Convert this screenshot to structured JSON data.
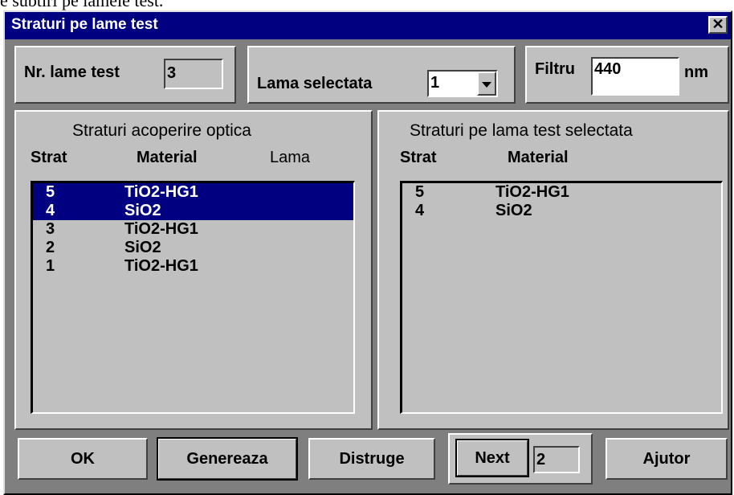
{
  "document": {
    "text_above": "e subtiri pe lamele test."
  },
  "window": {
    "title": "Straturi pe lame test",
    "close_glyph": "✕"
  },
  "top_row": {
    "nr_lame_label": "Nr. lame test",
    "nr_lame_value": "3",
    "lama_selectata_label": "Lama selectata",
    "lama_selectata_value": "1",
    "filtru_label": "Filtru",
    "filtru_value": "440",
    "filtru_unit": "nm"
  },
  "left_panel": {
    "title": "Straturi acoperire optica",
    "col_strat": "Strat",
    "col_material": "Material",
    "col_lama": "Lama",
    "rows": [
      {
        "strat": "5",
        "material": "TiO2-HG1",
        "lama": ""
      },
      {
        "strat": "4",
        "material": "SiO2",
        "lama": ""
      },
      {
        "strat": "3",
        "material": "TiO2-HG1",
        "lama": ""
      },
      {
        "strat": "2",
        "material": "SiO2",
        "lama": ""
      },
      {
        "strat": "1",
        "material": "TiO2-HG1",
        "lama": ""
      }
    ],
    "selected_rows": [
      "5",
      "4"
    ]
  },
  "right_panel": {
    "title": "Straturi pe lama test selectata",
    "col_strat": "Strat",
    "col_material": "Material",
    "rows": [
      {
        "strat": "5",
        "material": "TiO2-HG1"
      },
      {
        "strat": "4",
        "material": "SiO2"
      }
    ]
  },
  "buttons": {
    "ok": "OK",
    "genereaza": "Genereaza",
    "distruge": "Distruge",
    "next": "Next",
    "next_value": "2",
    "ajutor": "Ajutor"
  },
  "colors": {
    "titlebar": "#000080",
    "face": "#c0c0c0",
    "selection": "#000080",
    "frame": "#7f7f7f"
  },
  "icons": {
    "dropdown": "dropdown-arrow-icon"
  }
}
